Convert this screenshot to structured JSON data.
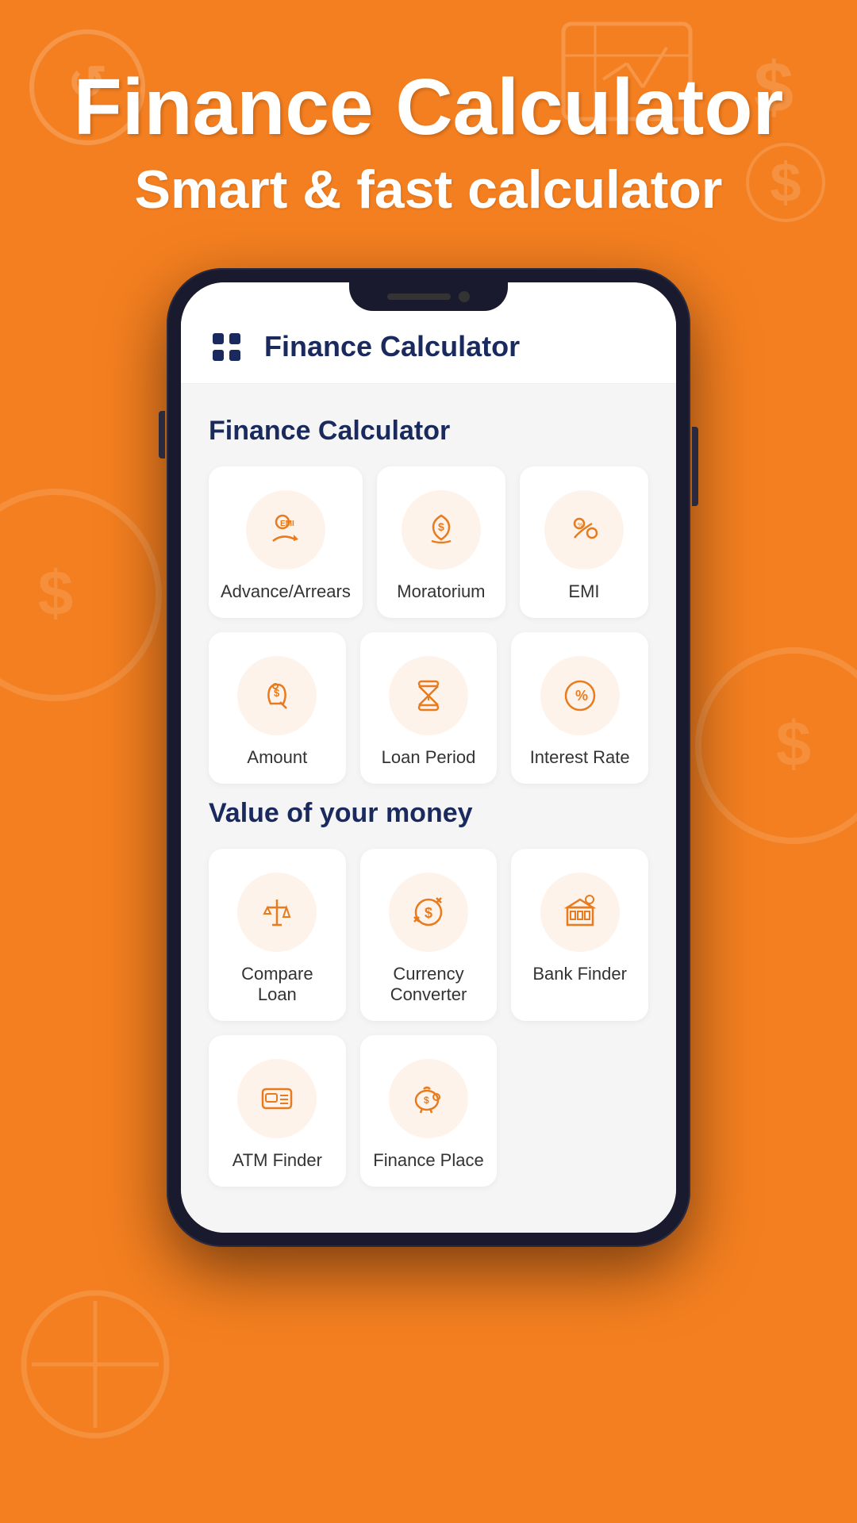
{
  "background": {
    "color": "#F47F20"
  },
  "header": {
    "main_title": "Finance Calculator",
    "sub_title": "Smart & fast calculator"
  },
  "app": {
    "title": "Finance Calculator",
    "menu_icon_label": "menu"
  },
  "section1": {
    "title": "Finance Calculator",
    "items": [
      {
        "id": "advance-arrears",
        "label": "Advance/Arrears",
        "icon": "emi-hand"
      },
      {
        "id": "moratorium",
        "label": "Moratorium",
        "icon": "money-bag"
      },
      {
        "id": "emi",
        "label": "EMI",
        "icon": "emi-percent"
      },
      {
        "id": "amount",
        "label": "Amount",
        "icon": "amount-bags"
      },
      {
        "id": "loan-period",
        "label": "Loan Period",
        "icon": "hourglass"
      },
      {
        "id": "interest-rate",
        "label": "Interest Rate",
        "icon": "percent"
      }
    ]
  },
  "section2": {
    "title": "Value of your money",
    "items": [
      {
        "id": "compare-loan",
        "label": "Compare Loan",
        "icon": "balance"
      },
      {
        "id": "currency-converter",
        "label": "Currency Converter",
        "icon": "currency"
      },
      {
        "id": "bank-finder",
        "label": "Bank Finder",
        "icon": "bank"
      },
      {
        "id": "atm-finder",
        "label": "ATM Finder",
        "icon": "atm"
      },
      {
        "id": "finance-place",
        "label": "Finance Place",
        "icon": "piggy"
      }
    ]
  }
}
